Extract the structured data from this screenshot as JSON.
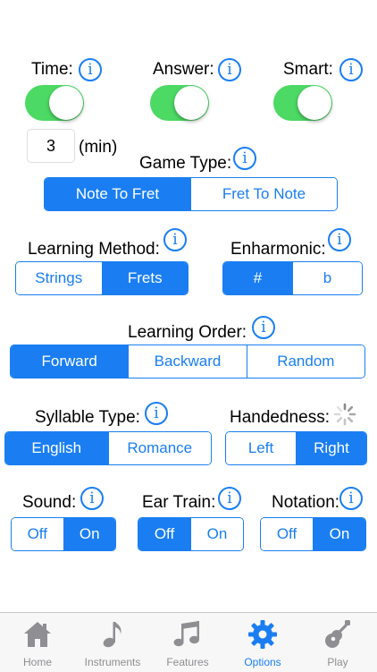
{
  "toggles": {
    "time": {
      "label": "Time:",
      "on": true
    },
    "answer": {
      "label": "Answer:",
      "on": true
    },
    "smart": {
      "label": "Smart:",
      "on": true
    }
  },
  "info_glyph": "i",
  "time_limit": {
    "value": "3",
    "unit": "(min)"
  },
  "game_type": {
    "label": "Game Type:",
    "options": [
      "Note To Fret",
      "Fret To Note"
    ],
    "selected": "Note To Fret"
  },
  "learning_method": {
    "label": "Learning Method:",
    "options": [
      "Strings",
      "Frets"
    ],
    "selected": "Frets"
  },
  "enharmonic": {
    "label": "Enharmonic:",
    "options": [
      "#",
      "b"
    ],
    "selected": "#"
  },
  "learning_order": {
    "label": "Learning Order:",
    "options": [
      "Forward",
      "Backward",
      "Random"
    ],
    "selected": "Forward"
  },
  "syllable_type": {
    "label": "Syllable Type:",
    "options": [
      "English",
      "Romance"
    ],
    "selected": "English"
  },
  "handedness": {
    "label": "Handedness:",
    "options": [
      "Left",
      "Right"
    ],
    "selected": "Right",
    "icon": "loading-spinner-icon"
  },
  "sound": {
    "label": "Sound:",
    "options": [
      "Off",
      "On"
    ],
    "selected": "On"
  },
  "ear_train": {
    "label": "Ear Train:",
    "options": [
      "Off",
      "On"
    ],
    "selected": "Off"
  },
  "notation": {
    "label": "Notation:",
    "options": [
      "Off",
      "On"
    ],
    "selected": "On"
  },
  "tabs": [
    {
      "label": "Home",
      "icon": "house-icon"
    },
    {
      "label": "Instruments",
      "icon": "music-note-icon"
    },
    {
      "label": "Features",
      "icon": "double-note-icon"
    },
    {
      "label": "Options",
      "icon": "gear-icon",
      "active": true
    },
    {
      "label": "Play",
      "icon": "guitar-icon"
    }
  ],
  "colors": {
    "accent": "#1a7ef2",
    "toggle_on": "#4cd964",
    "tab_inactive": "#8e8e93"
  }
}
